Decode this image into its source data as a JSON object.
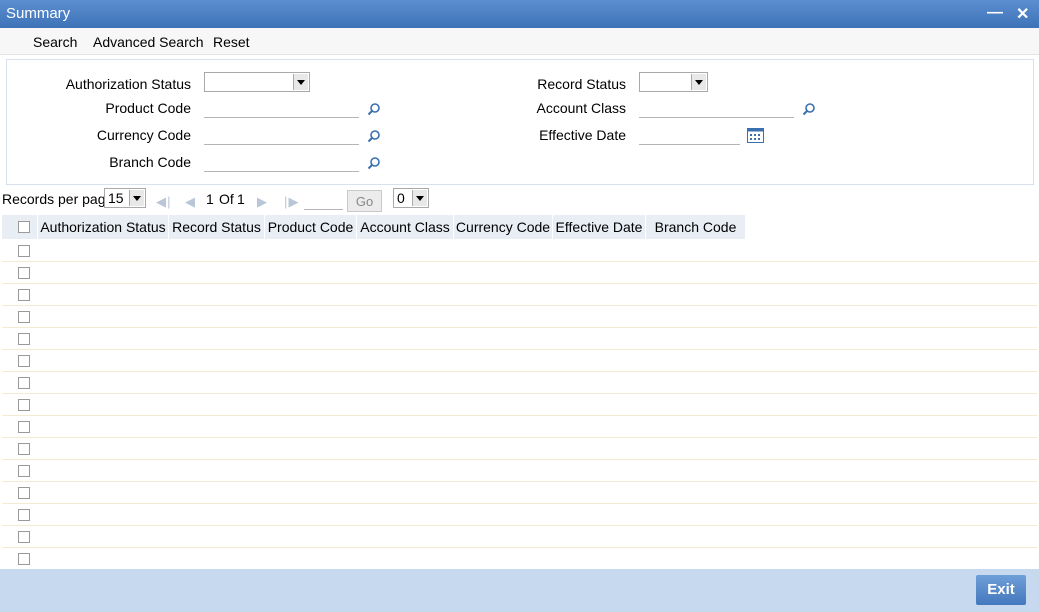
{
  "window": {
    "title": "Summary",
    "minimize_icon": "minimize-icon",
    "close_icon": "close-icon"
  },
  "toolbar": {
    "search": "Search",
    "advanced_search": "Advanced Search",
    "reset": "Reset"
  },
  "criteria": {
    "authorization_status": "Authorization Status",
    "product_code": "Product Code",
    "currency_code": "Currency Code",
    "branch_code": "Branch Code",
    "record_status": "Record Status",
    "account_class": "Account Class",
    "effective_date": "Effective Date"
  },
  "pager": {
    "records_per_page_label": "Records per page",
    "records_per_page": "15",
    "page_current": "1",
    "of_label": "Of",
    "page_total": "1",
    "go": "Go",
    "jump_value": "0"
  },
  "grid": {
    "columns": [
      "Authorization Status",
      "Record Status",
      "Product Code",
      "Account Class",
      "Currency Code",
      "Effective Date",
      "Branch Code"
    ],
    "row_count": 15
  },
  "footer": {
    "exit": "Exit"
  }
}
